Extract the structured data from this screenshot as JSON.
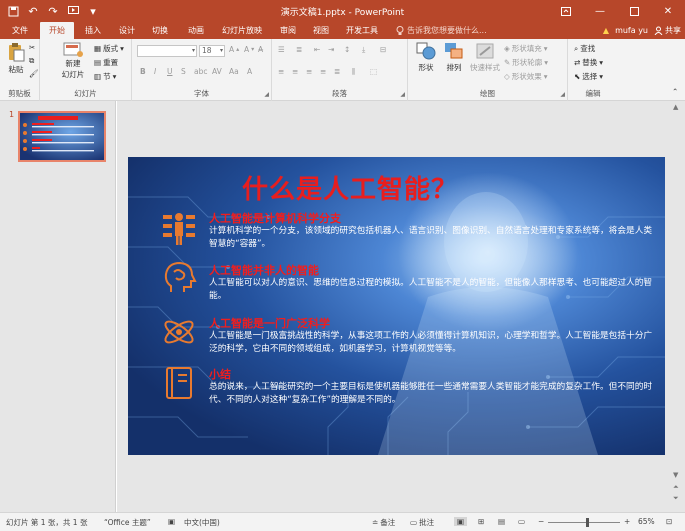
{
  "window": {
    "title": "演示文稿1.pptx - PowerPoint"
  },
  "tabs": [
    {
      "label": "文件"
    },
    {
      "label": "开始"
    },
    {
      "label": "插入"
    },
    {
      "label": "设计"
    },
    {
      "label": "切换"
    },
    {
      "label": "动画"
    },
    {
      "label": "幻灯片放映"
    },
    {
      "label": "审阅"
    },
    {
      "label": "视图"
    },
    {
      "label": "开发工具"
    }
  ],
  "tell_me": "告诉我您想要做什么...",
  "user": {
    "name": "mufa yu",
    "share": "共享"
  },
  "ribbon": {
    "clipboard": {
      "paste": "粘贴",
      "label": "剪贴板"
    },
    "slides": {
      "new_slide": "新建\n幻灯片",
      "new_slide_line1": "新建",
      "new_slide_line2": "幻灯片",
      "layout": "版式",
      "reset": "重置",
      "section": "节",
      "label": "幻灯片"
    },
    "font": {
      "name": "",
      "size": "18",
      "label": "字体"
    },
    "paragraph": {
      "label": "段落"
    },
    "drawing": {
      "shape": "形状",
      "arrange": "排列",
      "quick_styles": "快速样式",
      "fill": "形状填充",
      "outline": "形状轮廓",
      "effects": "形状效果",
      "label": "绘图"
    },
    "editing": {
      "find": "查找",
      "replace": "替换",
      "select": "选择",
      "label": "编辑"
    }
  },
  "thumbnail": {
    "number": "1"
  },
  "slide": {
    "title": "什么是人工智能？",
    "title_suffix": "？",
    "sections": [
      {
        "heading": "人工智能是计算机科学分支",
        "body": "计算机科学的一个分支，该领域的研究包括机器人、语言识别、图像识别、自然语言处理和专家系统等，将会是人类智慧的“容器”。"
      },
      {
        "heading": "人工智能并非人的智能",
        "body": "人工智能可以对人的意识、思维的信息过程的模拟。人工智能不是人的智能，但能像人那样思考、也可能超过人的智能。"
      },
      {
        "heading": "人工智能是一门广泛科学",
        "body": "人工智能是一门极富挑战性的科学，从事这项工作的人必须懂得计算机知识，心理学和哲学。人工智能是包括十分广泛的科学，它由不同的领域组成，如机器学习，计算机视觉等等。"
      },
      {
        "heading": "小结",
        "body": "总的说来，人工智能研究的一个主要目标是使机器能够胜任一些通常需要人类智能才能完成的复杂工作。但不同的时代、不同的人对这种“复杂工作”的理解是不同的。"
      }
    ]
  },
  "status": {
    "slide_info": "幻灯片 第 1 张，共 1 张",
    "theme": "“Office 主题”",
    "language": "中文(中国)",
    "notes": "备注",
    "comments": "批注",
    "zoom": "65%"
  },
  "colors": {
    "accent": "#b7472a",
    "slide_bg": "#1f4590",
    "heading_red": "#f01e1e",
    "icon_orange": "#e87a2f"
  }
}
